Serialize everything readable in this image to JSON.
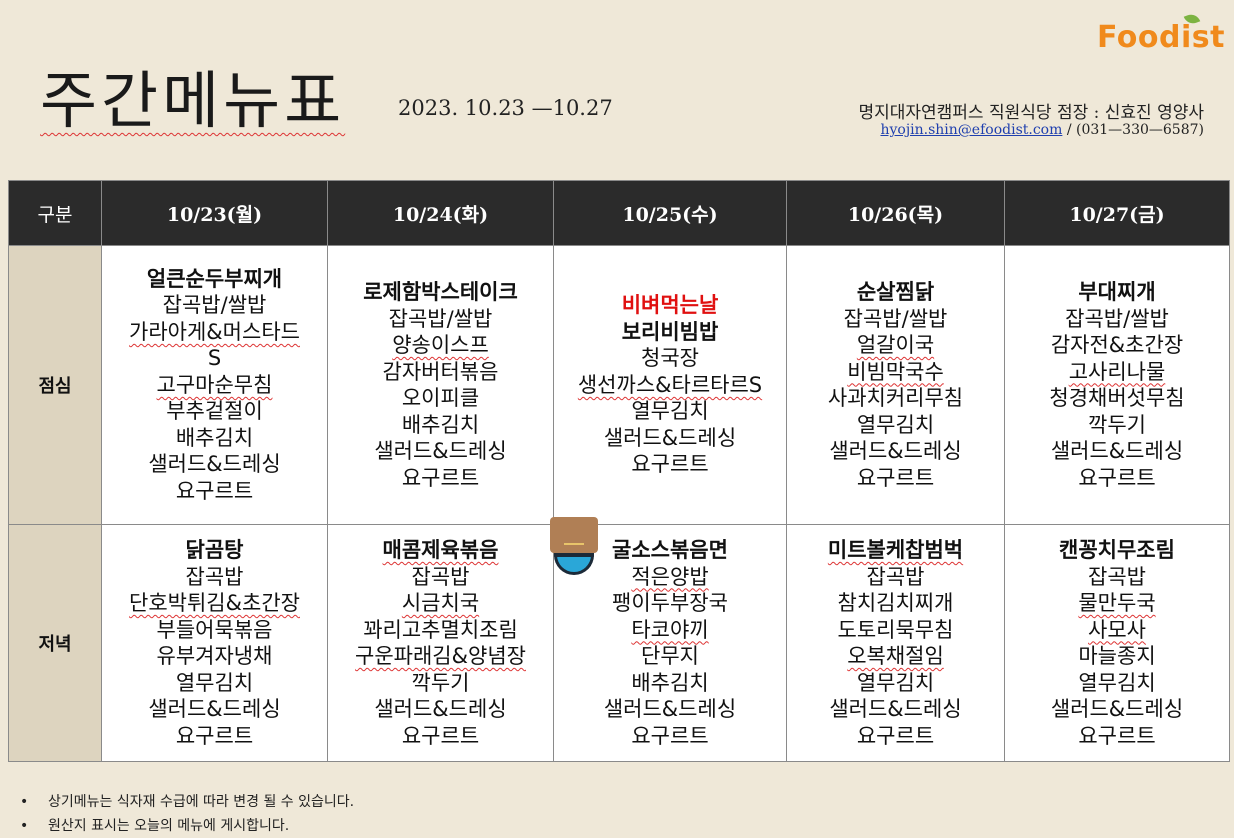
{
  "header": {
    "title": "주간메뉴표",
    "period": "2023. 10.23 —10.27",
    "logo": "Foodist",
    "place": "명지대자연캠퍼스 직원식당 점장 :  신효진 영양사",
    "email": "hyojin.shin@efoodist.com",
    "phone": "/ (031—330—6587)"
  },
  "table": {
    "corner": "구분",
    "days": [
      "10/23(월)",
      "10/24(화)",
      "10/25(수)",
      "10/26(목)",
      "10/27(금)"
    ],
    "rows": [
      {
        "label": "점심",
        "cells": [
          [
            "얼큰순두부찌개",
            "잡곡밥/쌀밥",
            "가라아게&머스타드",
            "S",
            "고구마순무침",
            "부추겉절이",
            "배추김치",
            "샐러드&드레싱",
            "요구르트"
          ],
          [
            "로제함박스테이크",
            "잡곡밥/쌀밥",
            "양송이스프",
            "감자버터볶음",
            "오이피클",
            "배추김치",
            "샐러드&드레싱",
            "요구르트"
          ],
          [
            "비벼먹는날",
            "보리비빔밥",
            "청국장",
            "생선까스&타르타르S",
            "열무김치",
            "샐러드&드레싱",
            "요구르트"
          ],
          [
            "순살찜닭",
            "잡곡밥/쌀밥",
            "얼갈이국",
            "비빔막국수",
            "사과치커리무침",
            "열무김치",
            "샐러드&드레싱",
            "요구르트"
          ],
          [
            "부대찌개",
            "잡곡밥/쌀밥",
            "감자전&초간장",
            "고사리나물",
            "청경채버섯무침",
            "깍두기",
            "샐러드&드레싱",
            "요구르트"
          ]
        ]
      },
      {
        "label": "저녁",
        "cells": [
          [
            "닭곰탕",
            "잡곡밥",
            "단호박튀김&초간장",
            "부들어묵볶음",
            "유부겨자냉채",
            "열무김치",
            "샐러드&드레싱",
            "요구르트"
          ],
          [
            "매콤제육볶음",
            "잡곡밥",
            "시금치국",
            "꽈리고추멸치조림",
            "구운파래김&양념장",
            "깍두기",
            "샐러드&드레싱",
            "요구르트"
          ],
          [
            "굴소스볶음면",
            "적은양밥",
            "팽이두부장국",
            "타코야끼",
            "단무지",
            "배추김치",
            "샐러드&드레싱",
            "요구르트"
          ],
          [
            "미트볼케찹범벅",
            "잡곡밥",
            "참치김치찌개",
            "도토리묵무침",
            "오복채절임",
            "열무김치",
            "샐러드&드레싱",
            "요구르트"
          ],
          [
            "캔꽁치무조림",
            "잡곡밥",
            "물만두국",
            "사모사",
            "마늘종지",
            "열무김치",
            "샐러드&드레싱",
            "요구르트"
          ]
        ]
      }
    ]
  },
  "notes": [
    "상기메뉴는 식자재 수급에 따라 변경 될 수 있습니다.",
    "원산지 표시는 오늘의 메뉴에 게시합니다."
  ],
  "bullet": "•",
  "colors": {
    "header_bg": "#2b2b2b",
    "label_bg": "#ddd4bf",
    "page_bg": "#efe8d8",
    "highlight": "#e01010",
    "logo": "#f08a1c"
  }
}
